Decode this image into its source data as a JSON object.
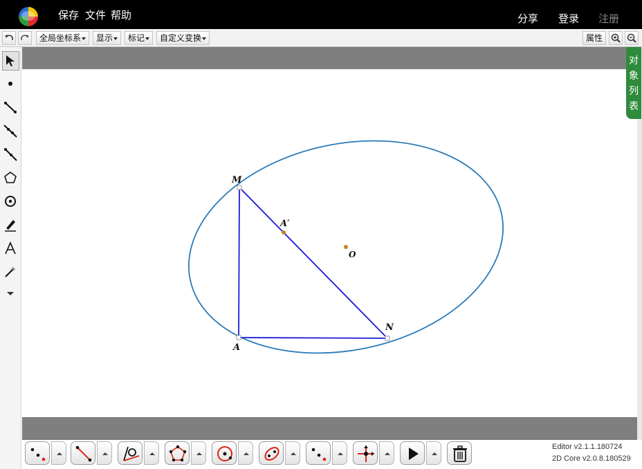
{
  "menu": {
    "save": "保存",
    "file": "文件",
    "help": "帮助"
  },
  "account": {
    "share": "分享",
    "login": "登录",
    "register": "注册"
  },
  "toolbar": {
    "coord_system": "全局坐标系",
    "display": "显示",
    "mark": "标记",
    "custom_transform": "自定义变换",
    "properties": "属性"
  },
  "object_list_tab": [
    "对",
    "象",
    "列",
    "表"
  ],
  "figure": {
    "labels": {
      "M": "M",
      "A_prime": "A′",
      "O": "O",
      "N": "N",
      "A": "A"
    },
    "colors": {
      "ellipse": "#2a7ab8",
      "triangle": "#1a1ad6",
      "point": "#c8861c"
    }
  },
  "version": {
    "editor": "Editor v2.1.1.180724",
    "core": "2D Core v2.0.8.180529"
  },
  "colors": {
    "topbar": "#000000",
    "band": "#7f7f7f",
    "object_tab": "#2e8b3a"
  },
  "icons": {
    "left_tools": [
      "move-arrow-icon",
      "point-icon",
      "segment-icon",
      "line-icon",
      "ray-icon",
      "polygon-icon",
      "circle-icon",
      "pen-icon",
      "text-icon",
      "magic-wand-icon",
      "more-icon"
    ],
    "bottom_tools": [
      "points-tool-icon",
      "line-tool-icon",
      "angle-tool-icon",
      "polygon-tool-icon",
      "circle-tool-icon",
      "ellipse-tool-icon",
      "dots-tool-icon",
      "transform-tool-icon",
      "play-icon",
      "trash-icon"
    ]
  }
}
